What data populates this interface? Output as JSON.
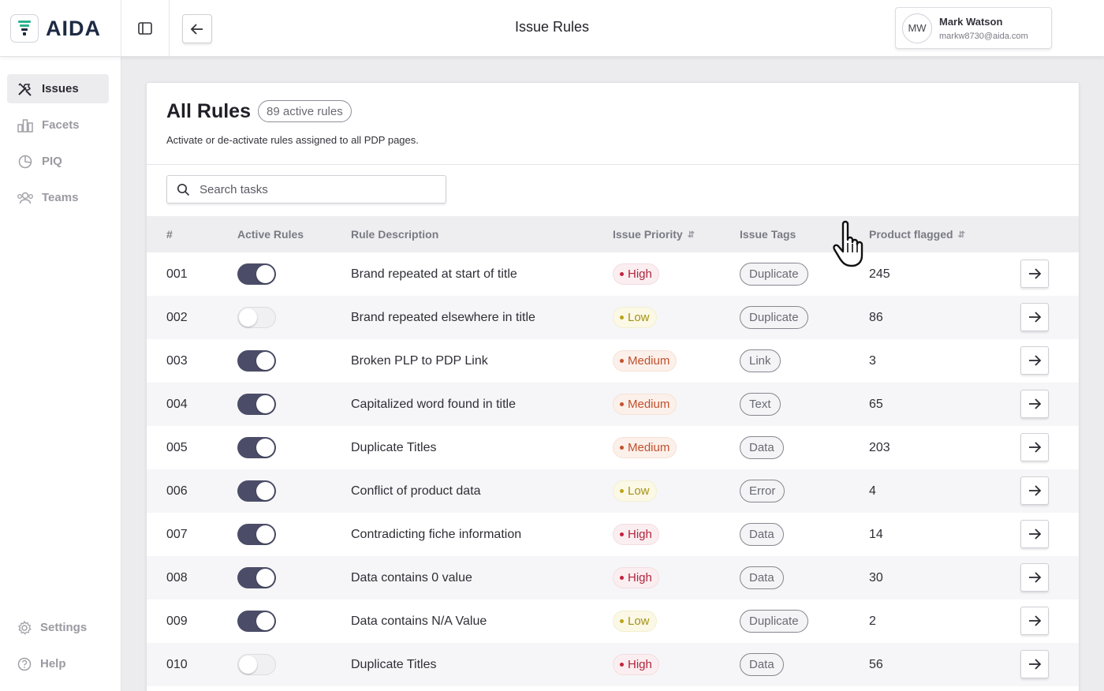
{
  "app": {
    "name": "AIDA"
  },
  "header": {
    "title": "Issue Rules"
  },
  "user": {
    "initials": "MW",
    "name": "Mark Watson",
    "email": "markw8730@aida.com"
  },
  "sidebar": {
    "items": [
      {
        "label": "Issues",
        "icon": "tools-icon",
        "active": true
      },
      {
        "label": "Facets",
        "icon": "bar-chart-icon",
        "active": false
      },
      {
        "label": "PIQ",
        "icon": "pie-chart-icon",
        "active": false
      },
      {
        "label": "Teams",
        "icon": "users-icon",
        "active": false
      }
    ],
    "bottom_items": [
      {
        "label": "Settings",
        "icon": "gear-icon"
      },
      {
        "label": "Help",
        "icon": "help-icon"
      }
    ]
  },
  "main": {
    "title": "All Rules",
    "badge": "89 active rules",
    "subtitle": "Activate or de-activate rules assigned to all PDP pages.",
    "search": {
      "placeholder": "Search tasks",
      "value": ""
    },
    "columns": [
      "#",
      "Active Rules",
      "Rule Description",
      "Issue Priority",
      "Issue Tags",
      "Product flagged"
    ],
    "rows": [
      {
        "id": "001",
        "active": true,
        "description": "Brand repeated at start of title",
        "priority": "High",
        "tag": "Duplicate",
        "flagged": "245"
      },
      {
        "id": "002",
        "active": false,
        "description": "Brand repeated elsewhere in title",
        "priority": "Low",
        "tag": "Duplicate",
        "flagged": "86"
      },
      {
        "id": "003",
        "active": true,
        "description": "Broken PLP to PDP Link",
        "priority": "Medium",
        "tag": "Link",
        "flagged": "3"
      },
      {
        "id": "004",
        "active": true,
        "description": "Capitalized word found in title",
        "priority": "Medium",
        "tag": "Text",
        "flagged": "65"
      },
      {
        "id": "005",
        "active": true,
        "description": "Duplicate Titles",
        "priority": "Medium",
        "tag": "Data",
        "flagged": "203"
      },
      {
        "id": "006",
        "active": true,
        "description": "Conflict of product data",
        "priority": "Low",
        "tag": "Error",
        "flagged": "4"
      },
      {
        "id": "007",
        "active": true,
        "description": "Contradicting fiche information",
        "priority": "High",
        "tag": "Data",
        "flagged": "14"
      },
      {
        "id": "008",
        "active": true,
        "description": "Data contains 0 value",
        "priority": "High",
        "tag": "Data",
        "flagged": "30"
      },
      {
        "id": "009",
        "active": true,
        "description": "Data contains N/A Value",
        "priority": "Low",
        "tag": "Duplicate",
        "flagged": "2"
      },
      {
        "id": "010",
        "active": false,
        "description": "Duplicate Titles",
        "priority": "High",
        "tag": "Data",
        "flagged": "56"
      }
    ]
  },
  "colors": {
    "toggle_on": "#4b4d68",
    "high": "#c4223d",
    "medium": "#c6502e",
    "low": "#b9a51a"
  }
}
